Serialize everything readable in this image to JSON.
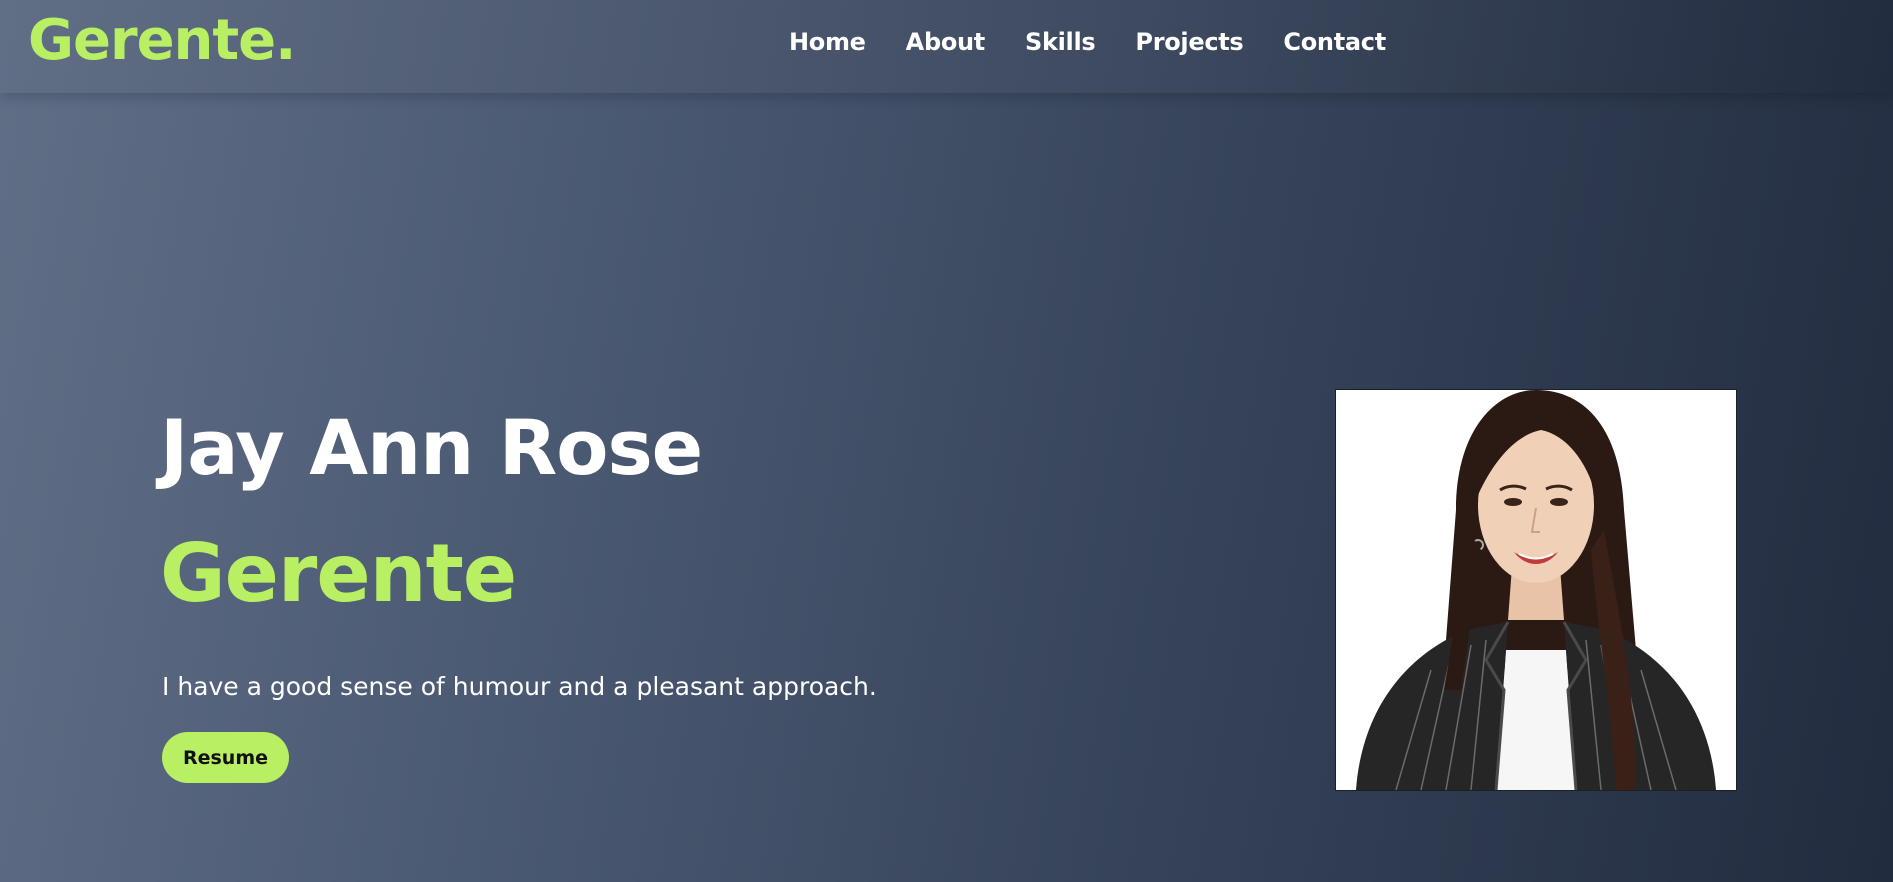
{
  "header": {
    "logo": "Gerente.",
    "nav": [
      {
        "label": "Home"
      },
      {
        "label": "About"
      },
      {
        "label": "Skills"
      },
      {
        "label": "Projects"
      },
      {
        "label": "Contact"
      }
    ]
  },
  "hero": {
    "first_name": "Jay Ann Rose",
    "last_name": "Gerente",
    "tagline": "I have a good sense of humour and a pleasant approach.",
    "resume_label": "Resume"
  },
  "colors": {
    "accent": "#b9ef62",
    "text": "#ffffff",
    "bg_left": "#606e86",
    "bg_right": "#222c3f"
  },
  "icons": {
    "profile": "profile-photo"
  }
}
